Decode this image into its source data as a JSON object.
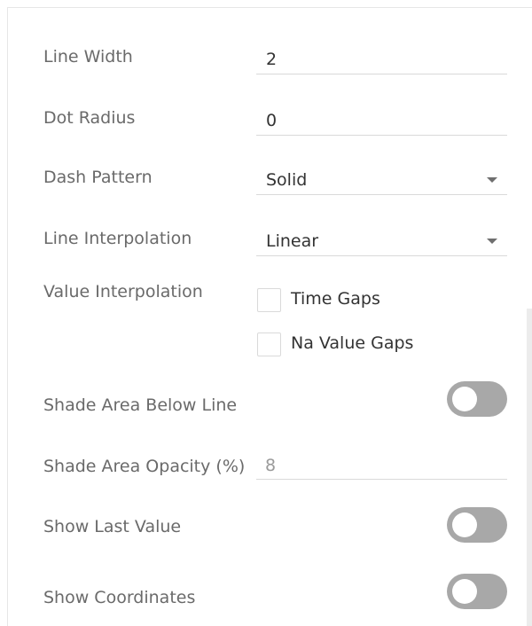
{
  "settings": {
    "line_width": {
      "label": "Line Width",
      "value": "2"
    },
    "dot_radius": {
      "label": "Dot Radius",
      "value": "0"
    },
    "dash_pattern": {
      "label": "Dash Pattern",
      "value": "Solid"
    },
    "line_interpolation": {
      "label": "Line Interpolation",
      "value": "Linear"
    },
    "value_interpolation": {
      "label": "Value Interpolation",
      "options": [
        {
          "label": "Time Gaps",
          "checked": false
        },
        {
          "label": "Na Value Gaps",
          "checked": false
        }
      ]
    },
    "shade_area_below_line": {
      "label": "Shade Area Below Line",
      "enabled": false
    },
    "shade_area_opacity": {
      "label": "Shade Area Opacity (%)",
      "value": "8"
    },
    "show_last_value": {
      "label": "Show Last Value",
      "enabled": false
    },
    "show_coordinates": {
      "label": "Show Coordinates",
      "enabled": false
    }
  },
  "colors": {
    "toggle_off": "#a8a8a8",
    "label_text": "#6a6a6a",
    "value_text": "#333333",
    "muted_value_text": "#9a9a9a"
  }
}
